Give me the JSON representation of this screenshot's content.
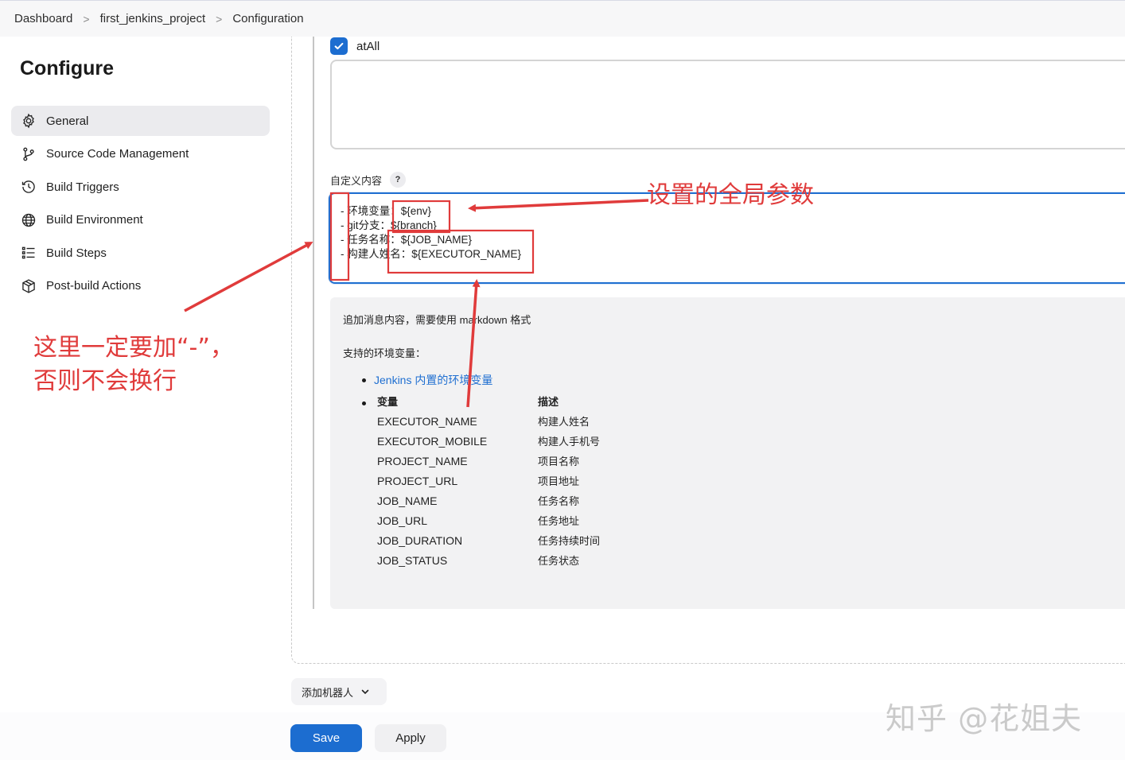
{
  "breadcrumb": {
    "items": [
      "Dashboard",
      "first_jenkins_project",
      "Configuration"
    ],
    "separator": ">"
  },
  "page": {
    "title": "Configure"
  },
  "nav": {
    "items": [
      {
        "label": "General",
        "icon": "gear-icon",
        "active": true
      },
      {
        "label": "Source Code Management",
        "icon": "branch-icon"
      },
      {
        "label": "Build Triggers",
        "icon": "clock-icon"
      },
      {
        "label": "Build Environment",
        "icon": "globe-icon"
      },
      {
        "label": "Build Steps",
        "icon": "list-icon"
      },
      {
        "label": "Post-build Actions",
        "icon": "package-icon"
      }
    ]
  },
  "form": {
    "atall_label": "atAll",
    "atall_checked": true,
    "custom_content_label": "自定义内容",
    "help_symbol": "?",
    "custom_content_lines": [
      "- 环境变量：${env}",
      "- git分支：${branch}",
      "- 任务名称：${JOB_NAME}",
      "- 构建人姓名：${EXECUTOR_NAME}"
    ]
  },
  "help": {
    "intro": "追加消息内容，需要使用 markdown 格式",
    "supported": "支持的环境变量：",
    "link_text": "Jenkins 内置的环境变量",
    "table_headers": [
      "变量",
      "描述"
    ],
    "rows": [
      [
        "EXECUTOR_NAME",
        "构建人姓名"
      ],
      [
        "EXECUTOR_MOBILE",
        "构建人手机号"
      ],
      [
        "PROJECT_NAME",
        "项目名称"
      ],
      [
        "PROJECT_URL",
        "项目地址"
      ],
      [
        "JOB_NAME",
        "任务名称"
      ],
      [
        "JOB_URL",
        "任务地址"
      ],
      [
        "JOB_DURATION",
        "任务持续时间"
      ],
      [
        "JOB_STATUS",
        "任务状态"
      ]
    ]
  },
  "actions": {
    "add_robot": "添加机器人",
    "save": "Save",
    "apply": "Apply"
  },
  "annotations": {
    "top": "设置的全局参数",
    "left_line1": "这里一定要加“-”，",
    "left_line2": "否则不会换行",
    "color": "#e03b3b"
  },
  "watermark": "知乎 @花姐夫",
  "colors": {
    "accent": "#1c6dd0",
    "annotation": "#e03b3b"
  }
}
